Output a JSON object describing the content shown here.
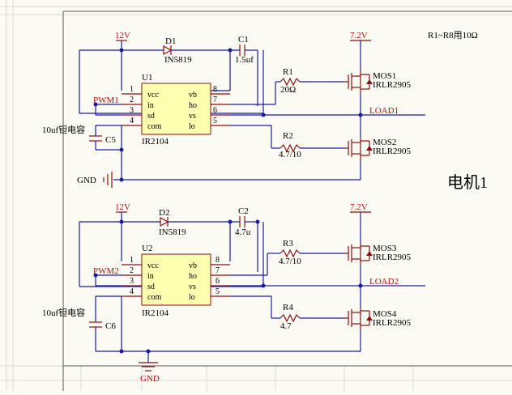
{
  "note": "R1~R8用10Ω",
  "title": "电机1",
  "top": {
    "vcc": "12V",
    "vcc_mos": "7.2V",
    "diode": {
      "ref": "D1",
      "part": "IN5819"
    },
    "cap": {
      "ref": "C1",
      "value": "1.5uf"
    },
    "ic": {
      "ref": "U1",
      "part": "IR2104"
    },
    "pwm": "PWM1",
    "c5": {
      "ref": "C5",
      "desc": "10uf钽电容"
    },
    "gnd": "GND",
    "r1": {
      "ref": "R1",
      "value": "20Ω"
    },
    "r2": {
      "ref": "R2",
      "value": "4.7/10"
    },
    "mos1": {
      "ref": "MOS1",
      "part": "IRLR2905"
    },
    "mos2": {
      "ref": "MOS2",
      "part": "IRLR2905"
    },
    "load": "LOAD1"
  },
  "bottom": {
    "vcc": "12V",
    "vcc_mos": "7.2V",
    "diode": {
      "ref": "D2",
      "part": "IN5819"
    },
    "cap": {
      "ref": "C2",
      "value": "4.7u"
    },
    "ic": {
      "ref": "U2",
      "part": "IR2104"
    },
    "pwm": "PWM2",
    "c6": {
      "ref": "C6",
      "desc": "10uf钽电容"
    },
    "gnd": "GND",
    "r3": {
      "ref": "R3",
      "value": "4.7/10"
    },
    "r4": {
      "ref": "R4",
      "value": "4.7"
    },
    "mos3": {
      "ref": "MOS3",
      "part": "IRLR2905"
    },
    "mos4": {
      "ref": "MOS4",
      "part": "IRLR2905"
    },
    "load": "LOAD2"
  },
  "ic_pins": {
    "left": [
      "vcc",
      "in",
      "sd",
      "com"
    ],
    "right": [
      "vb",
      "ho",
      "vs",
      "lo"
    ],
    "left_nums": [
      "1",
      "2",
      "3",
      "4"
    ],
    "right_nums": [
      "8",
      "7",
      "6",
      "5"
    ]
  }
}
